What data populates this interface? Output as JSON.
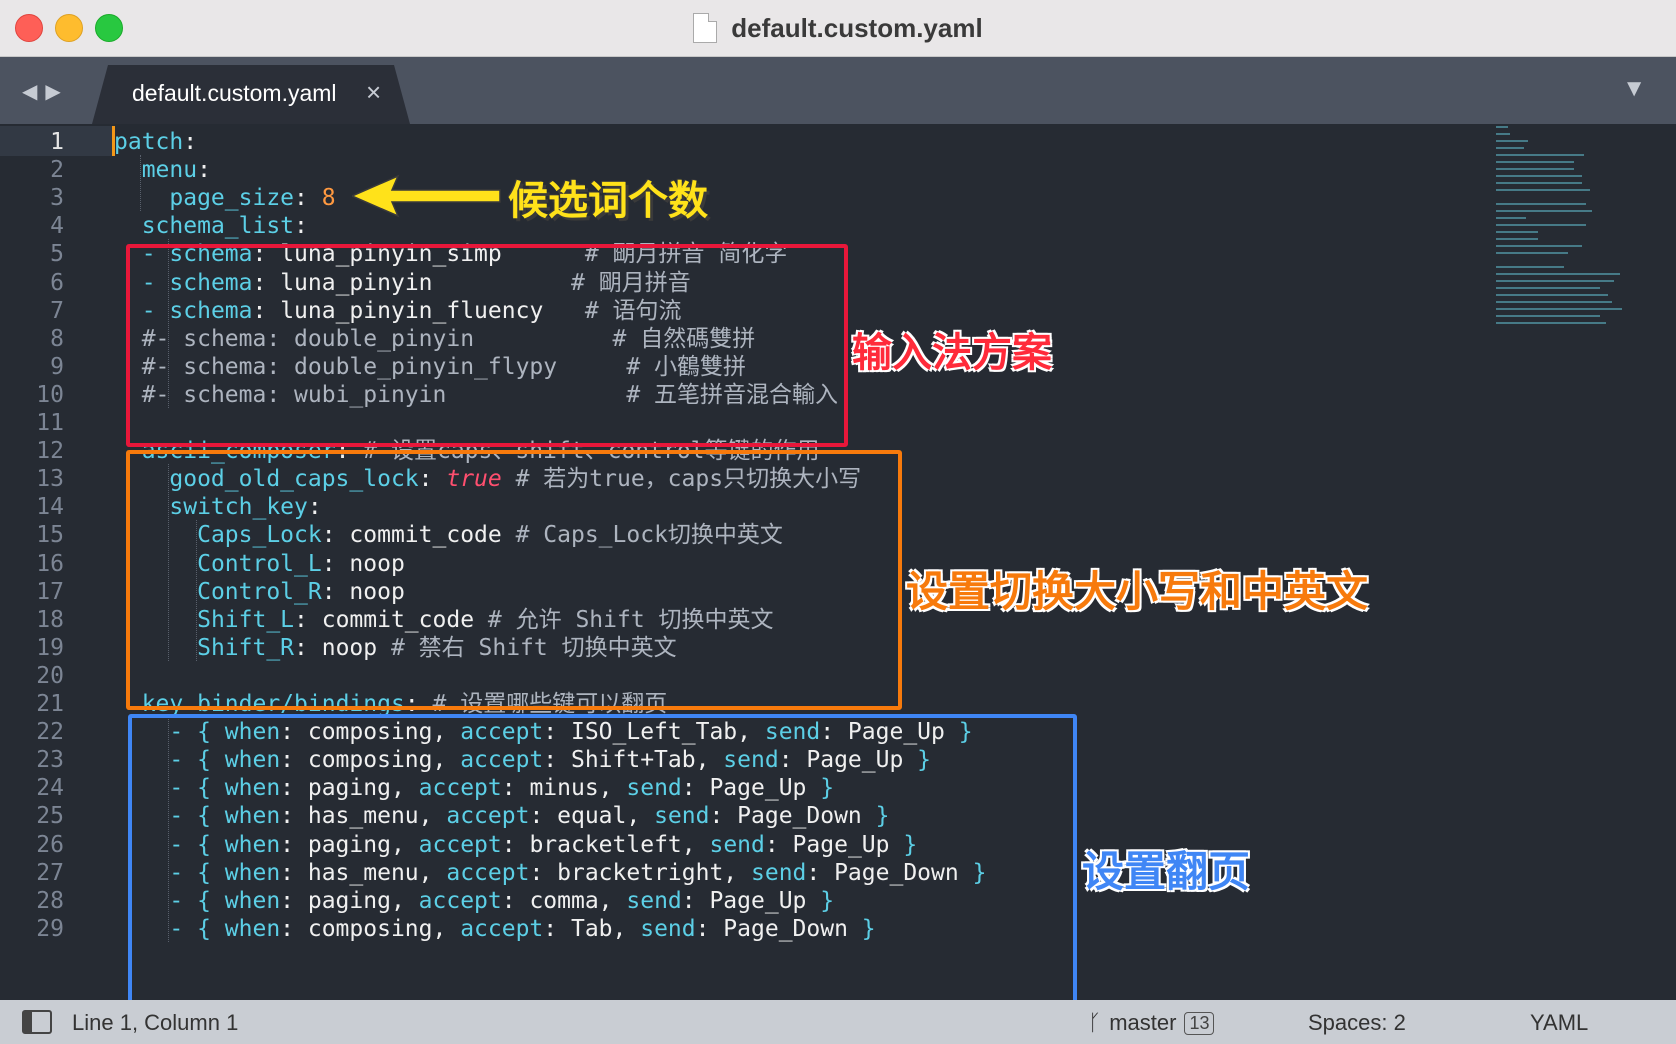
{
  "window": {
    "title": "default.custom.yaml"
  },
  "tabs": [
    {
      "label": "default.custom.yaml",
      "close": "×"
    }
  ],
  "icons": {
    "nav_back": "◀",
    "nav_forward": "▶",
    "dropdown": "▼",
    "branch": "ᚴ"
  },
  "editor": {
    "line_numbers": [
      "1",
      "2",
      "3",
      "4",
      "5",
      "6",
      "7",
      "8",
      "9",
      "10",
      "11",
      "12",
      "13",
      "14",
      "15",
      "16",
      "17",
      "18",
      "19",
      "20",
      "21",
      "22",
      "23",
      "24",
      "25",
      "26",
      "27",
      "28",
      "29"
    ],
    "lines": [
      [
        [
          "k",
          "patch"
        ],
        [
          "s",
          ":"
        ]
      ],
      [
        [
          "s",
          "  "
        ],
        [
          "k",
          "menu"
        ],
        [
          "s",
          ":"
        ]
      ],
      [
        [
          "s",
          "    "
        ],
        [
          "k",
          "page_size"
        ],
        [
          "s",
          ": "
        ],
        [
          "n",
          "8"
        ]
      ],
      [
        [
          "s",
          "  "
        ],
        [
          "k",
          "schema_list"
        ],
        [
          "s",
          ":"
        ]
      ],
      [
        [
          "s",
          "  "
        ],
        [
          "p",
          "- "
        ],
        [
          "k",
          "schema"
        ],
        [
          "s",
          ": luna_pinyin_simp      "
        ],
        [
          "c",
          "# 朙月拼音 简化字"
        ]
      ],
      [
        [
          "s",
          "  "
        ],
        [
          "p",
          "- "
        ],
        [
          "k",
          "schema"
        ],
        [
          "s",
          ": luna_pinyin          "
        ],
        [
          "c",
          "# 朙月拼音"
        ]
      ],
      [
        [
          "s",
          "  "
        ],
        [
          "p",
          "- "
        ],
        [
          "k",
          "schema"
        ],
        [
          "s",
          ": luna_pinyin_fluency   "
        ],
        [
          "c",
          "# 语句流"
        ]
      ],
      [
        [
          "s",
          "  "
        ],
        [
          "c",
          "#- schema: double_pinyin          # 自然碼雙拼"
        ]
      ],
      [
        [
          "s",
          "  "
        ],
        [
          "c",
          "#- schema: double_pinyin_flypy     # 小鶴雙拼"
        ]
      ],
      [
        [
          "s",
          "  "
        ],
        [
          "c",
          "#- schema: wubi_pinyin             # 五笔拼音混合輸入"
        ]
      ],
      [],
      [
        [
          "s",
          "  "
        ],
        [
          "k",
          "ascii_composer"
        ],
        [
          "s",
          ": "
        ],
        [
          "c",
          "# 设置caps、shift、control等键的作用"
        ]
      ],
      [
        [
          "s",
          "    "
        ],
        [
          "k",
          "good_old_caps_lock"
        ],
        [
          "s",
          ": "
        ],
        [
          "b",
          "true"
        ],
        [
          "s",
          " "
        ],
        [
          "c",
          "# 若为true，caps只切换大小写"
        ]
      ],
      [
        [
          "s",
          "    "
        ],
        [
          "k",
          "switch_key"
        ],
        [
          "s",
          ":"
        ]
      ],
      [
        [
          "s",
          "      "
        ],
        [
          "k",
          "Caps_Lock"
        ],
        [
          "s",
          ": commit_code "
        ],
        [
          "c",
          "# Caps_Lock切换中英文"
        ]
      ],
      [
        [
          "s",
          "      "
        ],
        [
          "k",
          "Control_L"
        ],
        [
          "s",
          ": noop"
        ]
      ],
      [
        [
          "s",
          "      "
        ],
        [
          "k",
          "Control_R"
        ],
        [
          "s",
          ": noop"
        ]
      ],
      [
        [
          "s",
          "      "
        ],
        [
          "k",
          "Shift_L"
        ],
        [
          "s",
          ": commit_code "
        ],
        [
          "c",
          "# 允许 Shift 切换中英文"
        ]
      ],
      [
        [
          "s",
          "      "
        ],
        [
          "k",
          "Shift_R"
        ],
        [
          "s",
          ": noop "
        ],
        [
          "c",
          "# 禁右 Shift 切换中英文"
        ]
      ],
      [],
      [
        [
          "s",
          "  "
        ],
        [
          "k",
          "key_binder/bindings"
        ],
        [
          "s",
          ": "
        ],
        [
          "c",
          "# 设置哪些键可以翻页"
        ]
      ],
      [
        [
          "s",
          "    "
        ],
        [
          "p",
          "- { "
        ],
        [
          "k",
          "when"
        ],
        [
          "s",
          ": composing, "
        ],
        [
          "k",
          "accept"
        ],
        [
          "s",
          ": ISO_Left_Tab, "
        ],
        [
          "k",
          "send"
        ],
        [
          "s",
          ": Page_Up "
        ],
        [
          "p",
          "}"
        ]
      ],
      [
        [
          "s",
          "    "
        ],
        [
          "p",
          "- { "
        ],
        [
          "k",
          "when"
        ],
        [
          "s",
          ": composing, "
        ],
        [
          "k",
          "accept"
        ],
        [
          "s",
          ": Shift+Tab, "
        ],
        [
          "k",
          "send"
        ],
        [
          "s",
          ": Page_Up "
        ],
        [
          "p",
          "}"
        ]
      ],
      [
        [
          "s",
          "    "
        ],
        [
          "p",
          "- { "
        ],
        [
          "k",
          "when"
        ],
        [
          "s",
          ": paging, "
        ],
        [
          "k",
          "accept"
        ],
        [
          "s",
          ": minus, "
        ],
        [
          "k",
          "send"
        ],
        [
          "s",
          ": Page_Up "
        ],
        [
          "p",
          "}"
        ]
      ],
      [
        [
          "s",
          "    "
        ],
        [
          "p",
          "- { "
        ],
        [
          "k",
          "when"
        ],
        [
          "s",
          ": has_menu, "
        ],
        [
          "k",
          "accept"
        ],
        [
          "s",
          ": equal, "
        ],
        [
          "k",
          "send"
        ],
        [
          "s",
          ": Page_Down "
        ],
        [
          "p",
          "}"
        ]
      ],
      [
        [
          "s",
          "    "
        ],
        [
          "p",
          "- { "
        ],
        [
          "k",
          "when"
        ],
        [
          "s",
          ": paging, "
        ],
        [
          "k",
          "accept"
        ],
        [
          "s",
          ": bracketleft, "
        ],
        [
          "k",
          "send"
        ],
        [
          "s",
          ": Page_Up "
        ],
        [
          "p",
          "}"
        ]
      ],
      [
        [
          "s",
          "    "
        ],
        [
          "p",
          "- { "
        ],
        [
          "k",
          "when"
        ],
        [
          "s",
          ": has_menu, "
        ],
        [
          "k",
          "accept"
        ],
        [
          "s",
          ": bracketright, "
        ],
        [
          "k",
          "send"
        ],
        [
          "s",
          ": Page_Down "
        ],
        [
          "p",
          "}"
        ]
      ],
      [
        [
          "s",
          "    "
        ],
        [
          "p",
          "- { "
        ],
        [
          "k",
          "when"
        ],
        [
          "s",
          ": paging, "
        ],
        [
          "k",
          "accept"
        ],
        [
          "s",
          ": comma, "
        ],
        [
          "k",
          "send"
        ],
        [
          "s",
          ": Page_Up "
        ],
        [
          "p",
          "}"
        ]
      ],
      [
        [
          "s",
          "    "
        ],
        [
          "p",
          "- { "
        ],
        [
          "k",
          "when"
        ],
        [
          "s",
          ": composing, "
        ],
        [
          "k",
          "accept"
        ],
        [
          "s",
          ": Tab, "
        ],
        [
          "k",
          "send"
        ],
        [
          "s",
          ": Page_Down "
        ],
        [
          "p",
          "}"
        ]
      ]
    ]
  },
  "annotations": {
    "candidates": "候选词个数",
    "input_schemes": "输入法方案",
    "switch_case": "设置切换大小写和中英文",
    "paging": "设置翻页"
  },
  "statusbar": {
    "position": "Line 1, Column 1",
    "branch": "master",
    "branch_count": "13",
    "spaces": "Spaces: 2",
    "syntax": "YAML"
  },
  "colors": {
    "red_box": "#e8173a",
    "orange_box": "#f77a0c",
    "blue_box": "#3f86f5",
    "yellow_arrow": "#ffe21a",
    "key": "#5ccfe6",
    "number": "#ff9940",
    "bool": "#ff4f6f"
  }
}
